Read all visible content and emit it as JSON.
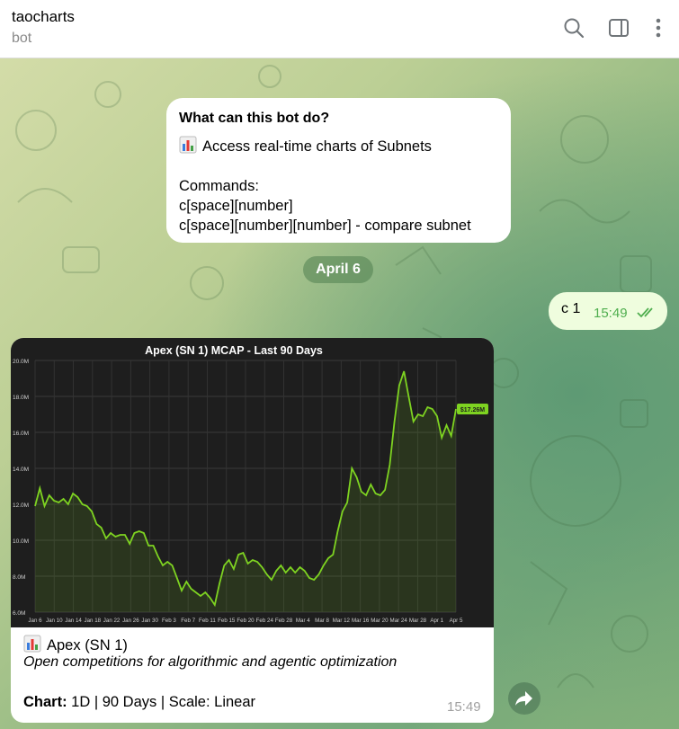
{
  "header": {
    "title": "taocharts",
    "subtitle": "bot",
    "icons": [
      "search-icon",
      "sidebar-toggle-icon",
      "more-vertical-icon"
    ]
  },
  "info_card": {
    "heading": "What can this bot do?",
    "line1": "Access real-time charts of Subnets",
    "commands_label": "Commands:",
    "cmd1": "c[space][number]",
    "cmd2": "c[space][number][number] - compare subnet"
  },
  "date_separator": "April 6",
  "outgoing": {
    "text": "c 1",
    "time": "15:49",
    "status": "read"
  },
  "bot_message": {
    "title": "Apex (SN 1)",
    "description": "Open competitions for algorithmic and agentic optimization",
    "meta_label": "Chart:",
    "meta_value": " 1D | 90 Days | Scale: Linear",
    "time": "15:49"
  },
  "colors": {
    "line": "#7ed321",
    "chart_bg": "#1e1e1e",
    "outgoing_bubble": "#effdde",
    "read_ticks": "#4fae4e"
  },
  "chart_data": {
    "type": "area",
    "title": "Apex (SN 1) MCAP - Last 90 Days",
    "xlabel": "",
    "ylabel": "",
    "ylim": [
      6.0,
      20.0
    ],
    "y_ticks": [
      "6.0M",
      "8.0M",
      "10.0M",
      "12.0M",
      "14.0M",
      "16.0M",
      "18.0M",
      "20.0M"
    ],
    "x_ticks": [
      "Jan 6",
      "Jan 10",
      "Jan 14",
      "Jan 18",
      "Jan 22",
      "Jan 26",
      "Jan 30",
      "Feb 3",
      "Feb 7",
      "Feb 11",
      "Feb 15",
      "Feb 20",
      "Feb 24",
      "Feb 28",
      "Mar 4",
      "Mar 8",
      "Mar 12",
      "Mar 16",
      "Mar 20",
      "Mar 24",
      "Mar 28",
      "Apr 1",
      "Apr 5"
    ],
    "last_value_label": "$17.26M",
    "grid": true,
    "series": [
      {
        "values": [
          11.9,
          12.9,
          11.9,
          12.5,
          12.2,
          12.1,
          12.3,
          12.0,
          12.6,
          12.4,
          12.0,
          11.9,
          11.6,
          10.9,
          10.7,
          10.1,
          10.4,
          10.2,
          10.3,
          10.3,
          9.8,
          10.4,
          10.5,
          10.4,
          9.7,
          9.7,
          9.1,
          8.6,
          8.8,
          8.6,
          7.9,
          7.2,
          7.7,
          7.3,
          7.1,
          6.9,
          7.1,
          6.8,
          6.4,
          7.6,
          8.6,
          8.9,
          8.4,
          9.2,
          9.3,
          8.7,
          8.9,
          8.8,
          8.5,
          8.1,
          7.8,
          8.3,
          8.6,
          8.2,
          8.5,
          8.2,
          8.5,
          8.3,
          7.9,
          7.8,
          8.1,
          8.6,
          9.0,
          9.2,
          10.5,
          11.6,
          12.1,
          14.0,
          13.5,
          12.7,
          12.5,
          13.1,
          12.6,
          12.5,
          12.8,
          14.2,
          16.6,
          18.6,
          19.4,
          18.0,
          16.6,
          17.0,
          16.9,
          17.4,
          17.3,
          16.9,
          15.7,
          16.4,
          15.8,
          17.3
        ]
      }
    ]
  }
}
